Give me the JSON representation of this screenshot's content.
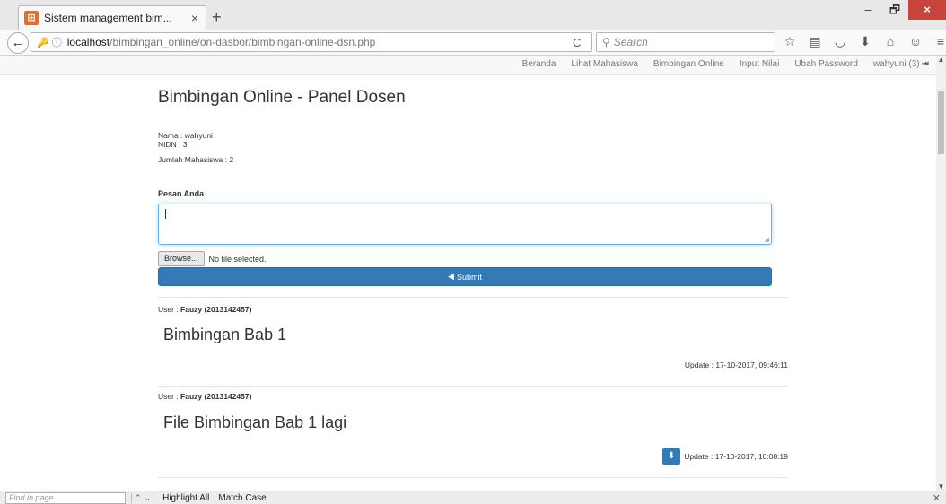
{
  "browser": {
    "tab_title": "Sistem management bim...",
    "tab_close": "×",
    "new_tab": "+",
    "url_icons": "🔑 ⓘ",
    "url_host": "localhost",
    "url_path": "/bimbingan_online/on-dasbor/bimbingan-online-dsn.php",
    "reload": "C",
    "search_placeholder": "Search",
    "window_controls": {
      "minimize": "–",
      "restore": "🗗",
      "close": "×"
    },
    "toolbar_icons": [
      "star-icon",
      "reading-list-icon",
      "pocket-icon",
      "download-icon",
      "home-icon",
      "account-icon",
      "menu-icon"
    ]
  },
  "site_nav": {
    "items": [
      "Beranda",
      "Lihat Mahasiswa",
      "Bimbingan Online",
      "Input Nilai",
      "Ubah Password"
    ],
    "user": "wahyuni (3)"
  },
  "page": {
    "title": "Bimbingan Online - Panel Dosen",
    "nama": "Nama : wahyuni",
    "nidn": "NIDN : 3",
    "jumlah": "Jumlah Mahasiswa : 2",
    "pesan_label": "Pesan Anda",
    "browse_label": "Browse...",
    "file_status": "No file selected.",
    "submit_label": "Submit"
  },
  "posts": [
    {
      "user_prefix": "User : ",
      "user_name": "Fauzy (2013142457)",
      "title": "Bimbingan Bab 1",
      "update": "Update : 17-10-2017, 09:46:11",
      "has_attachment": false
    },
    {
      "user_prefix": "User : ",
      "user_name": "Fauzy (2013142457)",
      "title": "File Bimbingan Bab 1 lagi",
      "update": "Update : 17-10-2017, 10:08:19",
      "has_attachment": true
    }
  ],
  "findbar": {
    "placeholder": "Find in page",
    "highlight_all": "Highlight All",
    "match_case": "Match Case"
  },
  "colors": {
    "primary": "#337ab7",
    "focus": "#66afe9",
    "close_red": "#c8453c"
  }
}
